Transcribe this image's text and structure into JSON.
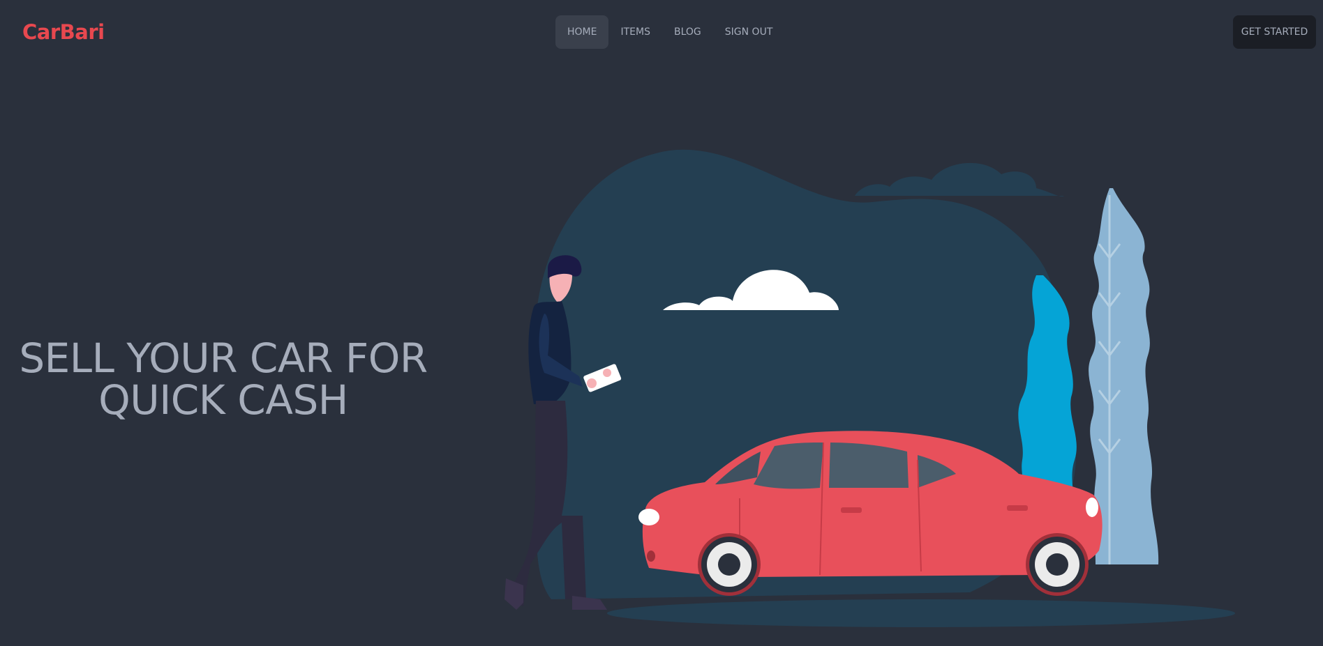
{
  "brand": {
    "name": "CarBari",
    "color": "#e8484f"
  },
  "nav": {
    "items": [
      {
        "label": "HOME",
        "active": true
      },
      {
        "label": "ITEMS",
        "active": false
      },
      {
        "label": "BLOG",
        "active": false
      },
      {
        "label": "SIGN OUT",
        "active": false
      }
    ]
  },
  "cta": {
    "label": "GET STARTED"
  },
  "hero": {
    "title_line1": "SELL YOUR CAR FOR",
    "title_line2": "QUICK CASH"
  },
  "illustration": {
    "icon": "man-with-car-illustration",
    "colors": {
      "background": "#2a303c",
      "blob": "#243f52",
      "car": "#e8505b",
      "cloud": "#ffffff",
      "tree_blue": "#05a4d6",
      "tree_light": "#8bb4d3",
      "person_dark": "#142340"
    }
  }
}
